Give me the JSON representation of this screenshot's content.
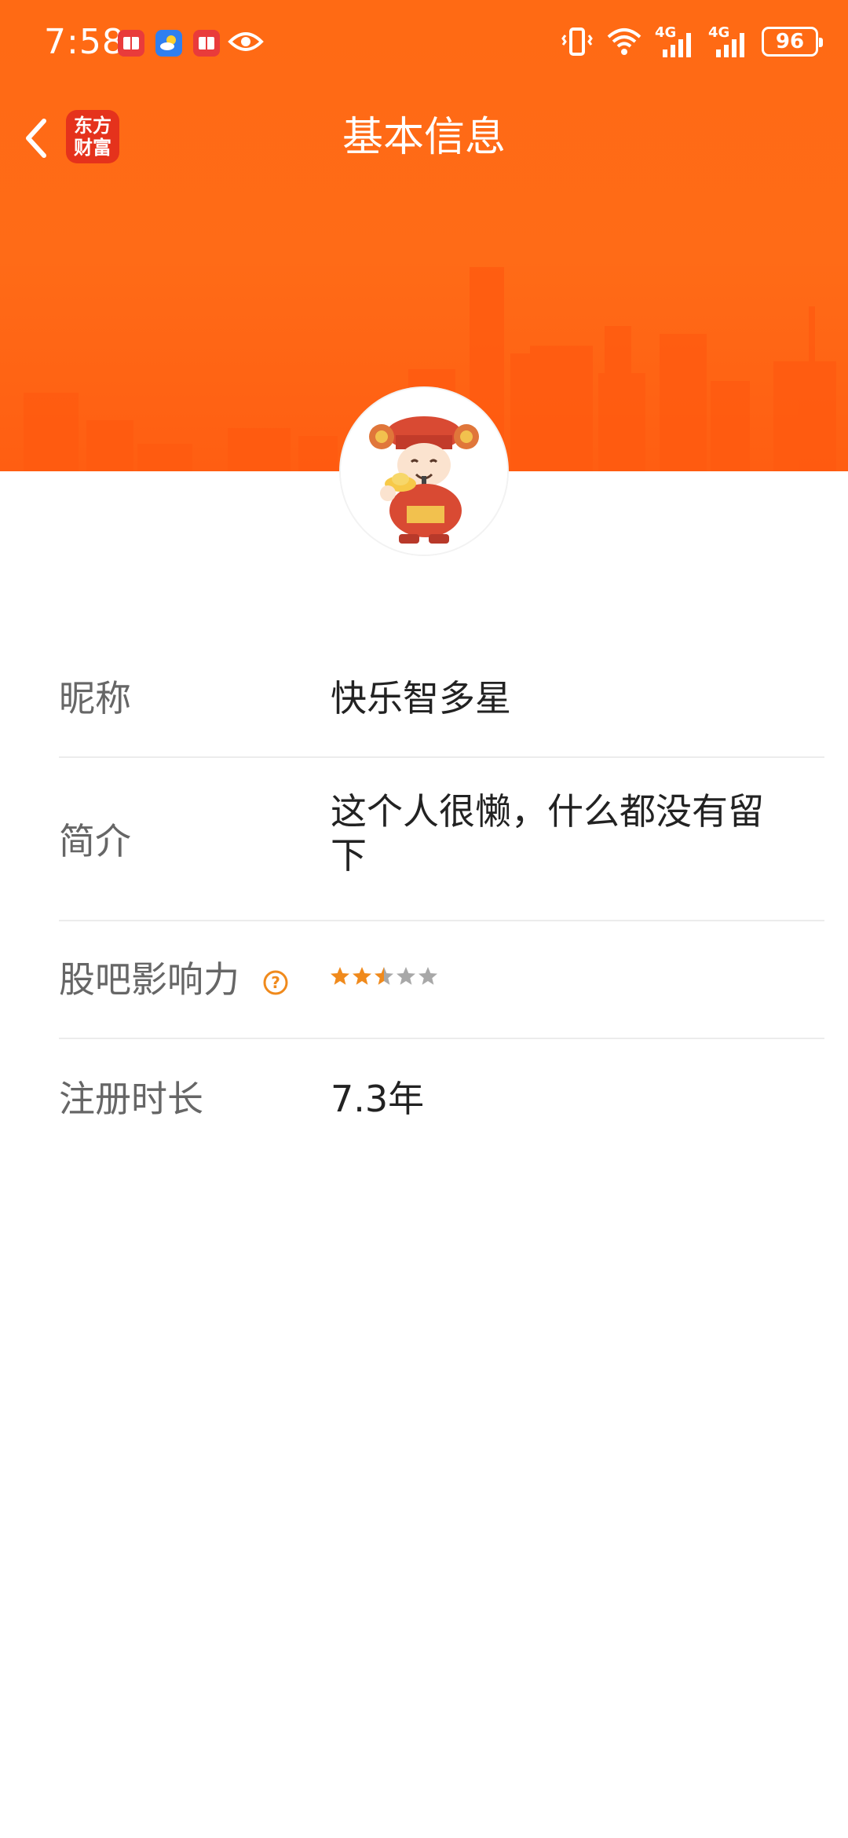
{
  "status_bar": {
    "time": "7:58",
    "battery": "96",
    "network_1": "4G",
    "network_2": "4G"
  },
  "nav": {
    "title": "基本信息",
    "app_badge_line1": "东方",
    "app_badge_line2": "财富"
  },
  "profile": {
    "rows": [
      {
        "label": "昵称",
        "value": "快乐智多星"
      },
      {
        "label": "简介",
        "value": "这个人很懒，什么都没有留下"
      },
      {
        "label": "股吧影响力",
        "rating": 2.5,
        "rating_max": 5
      },
      {
        "label": "注册时长",
        "value": "7.3年"
      }
    ]
  },
  "colors": {
    "header_orange": "#ff6a14",
    "star_filled": "#f08a1c",
    "star_empty": "#a8a8a8",
    "help_icon": "#f08a1c"
  }
}
